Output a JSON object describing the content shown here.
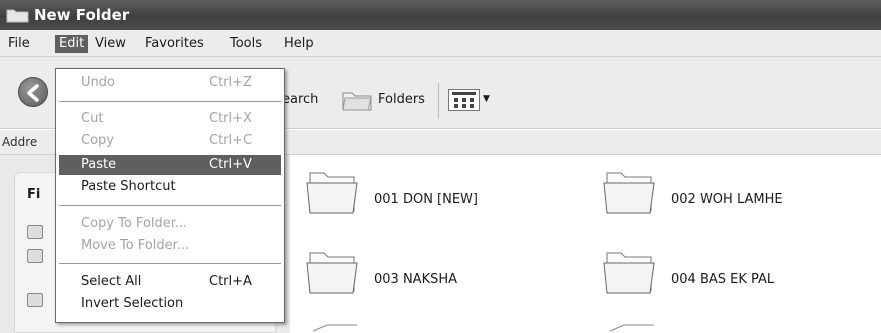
{
  "window": {
    "title": "New Folder"
  },
  "menubar": {
    "items": [
      {
        "label": "File"
      },
      {
        "label": "Edit"
      },
      {
        "label": "View"
      },
      {
        "label": "Favorites"
      },
      {
        "label": "Tools"
      },
      {
        "label": "Help"
      }
    ]
  },
  "toolbar": {
    "search_label": "earch",
    "folders_label": "Folders"
  },
  "addressbar": {
    "label": "Addre"
  },
  "taskpane": {
    "title": "Fi"
  },
  "edit_menu": {
    "undo": {
      "label": "Undo",
      "shortcut": "Ctrl+Z"
    },
    "cut": {
      "label": "Cut",
      "shortcut": "Ctrl+X"
    },
    "copy": {
      "label": "Copy",
      "shortcut": "Ctrl+C"
    },
    "paste": {
      "label": "Paste",
      "shortcut": "Ctrl+V"
    },
    "paste_shortcut": {
      "label": "Paste Shortcut"
    },
    "copy_to_folder": {
      "label": "Copy To Folder..."
    },
    "move_to_folder": {
      "label": "Move To Folder..."
    },
    "select_all": {
      "label": "Select All",
      "shortcut": "Ctrl+A"
    },
    "invert_selection": {
      "label": "Invert Selection"
    }
  },
  "folders": [
    {
      "name": "001 DON [NEW]"
    },
    {
      "name": "002 WOH LAMHE"
    },
    {
      "name": "003 NAKSHA"
    },
    {
      "name": "004 BAS EK PAL"
    }
  ]
}
